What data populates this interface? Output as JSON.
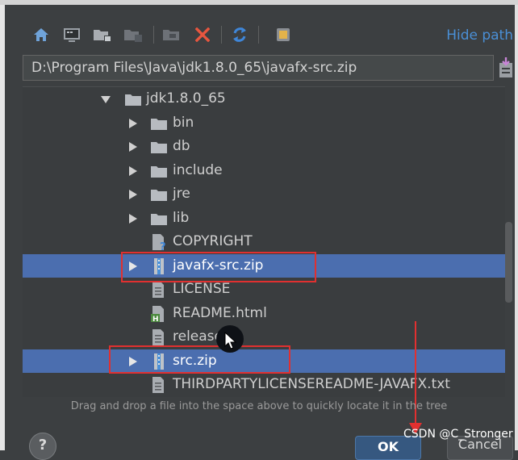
{
  "toolbar": {
    "hide_path_label": "Hide path",
    "icons": [
      "home-icon",
      "desktop-icon",
      "project-folder-icon",
      "module-folder-icon",
      "new-folder-icon",
      "delete-icon",
      "refresh-icon",
      "show-hidden-icon"
    ],
    "colors": {
      "accent": "#4a8fd6",
      "delete": "#e8563f",
      "refresh": "#3f86d8"
    }
  },
  "path_field": {
    "value": "D:\\Program Files\\Java\\jdk1.8.0_65\\javafx-src.zip"
  },
  "tree": {
    "root": {
      "label": "jdk1.8.0_65",
      "expanded": true
    },
    "items": [
      {
        "label": "bin",
        "type": "folder"
      },
      {
        "label": "db",
        "type": "folder"
      },
      {
        "label": "include",
        "type": "folder"
      },
      {
        "label": "jre",
        "type": "folder"
      },
      {
        "label": "lib",
        "type": "folder"
      },
      {
        "label": "COPYRIGHT",
        "type": "unknown-file"
      },
      {
        "label": "javafx-src.zip",
        "type": "archive",
        "selected": true
      },
      {
        "label": "LICENSE",
        "type": "text-file"
      },
      {
        "label": "README.html",
        "type": "html-file"
      },
      {
        "label": "release",
        "type": "text-file"
      },
      {
        "label": "src.zip",
        "type": "archive",
        "selected": true
      },
      {
        "label": "THIRDPARTYLICENSEREADME-JAVAFX.txt",
        "type": "text-file"
      }
    ],
    "selection_color": "#4b6eaf"
  },
  "hint": "Drag and drop a file into the space above to quickly locate it in the tree",
  "footer": {
    "help_label": "?",
    "ok_label": "OK",
    "cancel_label": "Cancel",
    "watermark": "CSDN @C_Stronger"
  },
  "annotation_color": "#e03030"
}
